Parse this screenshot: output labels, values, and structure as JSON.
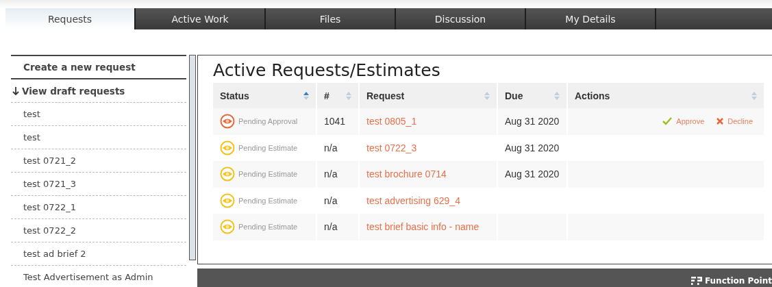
{
  "tabs": [
    {
      "label": "Requests",
      "selected": true
    },
    {
      "label": "Active Work",
      "selected": false
    },
    {
      "label": "Files",
      "selected": false
    },
    {
      "label": "Discussion",
      "selected": false
    },
    {
      "label": "My Details",
      "selected": false
    }
  ],
  "sidebar": {
    "items": [
      {
        "label": "Create a new request",
        "kind": "action"
      },
      {
        "label": "View draft requests",
        "kind": "toggle"
      },
      {
        "label": "test",
        "kind": "draft"
      },
      {
        "label": "test",
        "kind": "draft"
      },
      {
        "label": "test 0721_2",
        "kind": "draft"
      },
      {
        "label": "test 0721_3",
        "kind": "draft"
      },
      {
        "label": "test 0722_1",
        "kind": "draft"
      },
      {
        "label": "test 0722_2",
        "kind": "draft"
      },
      {
        "label": "test ad brief 2",
        "kind": "draft"
      },
      {
        "label": "Test Advertisement as Admin",
        "kind": "draft"
      }
    ]
  },
  "main": {
    "title": "Active Requests/Estimates",
    "table": {
      "columns": [
        {
          "label": "Status",
          "sorted": true
        },
        {
          "label": "#",
          "sorted": false
        },
        {
          "label": "Request",
          "sorted": false
        },
        {
          "label": "Due",
          "sorted": false
        },
        {
          "label": "Actions",
          "sorted": false
        }
      ],
      "rows": [
        {
          "status": {
            "kind": "approval",
            "label": "Pending Approval"
          },
          "number": "1041",
          "request": "test 0805_1",
          "due": "Aug 31 2020",
          "actions": [
            {
              "kind": "approve",
              "label": "Approve"
            },
            {
              "kind": "decline",
              "label": "Decline"
            }
          ]
        },
        {
          "status": {
            "kind": "estimate",
            "label": "Pending Estimate"
          },
          "number": "n/a",
          "request": "test 0722_3",
          "due": "Aug 31 2020"
        },
        {
          "status": {
            "kind": "estimate",
            "label": "Pending Estimate"
          },
          "number": "n/a",
          "request": "test brochure 0714",
          "due": "Aug 31 2020"
        },
        {
          "status": {
            "kind": "estimate",
            "label": "Pending Estimate"
          },
          "number": "n/a",
          "request": "test advertising 629_4"
        },
        {
          "status": {
            "kind": "estimate",
            "label": "Pending Estimate"
          },
          "number": "n/a",
          "request": "test brief basic info - name"
        }
      ]
    }
  },
  "footer": {
    "brand": "Function Point"
  }
}
